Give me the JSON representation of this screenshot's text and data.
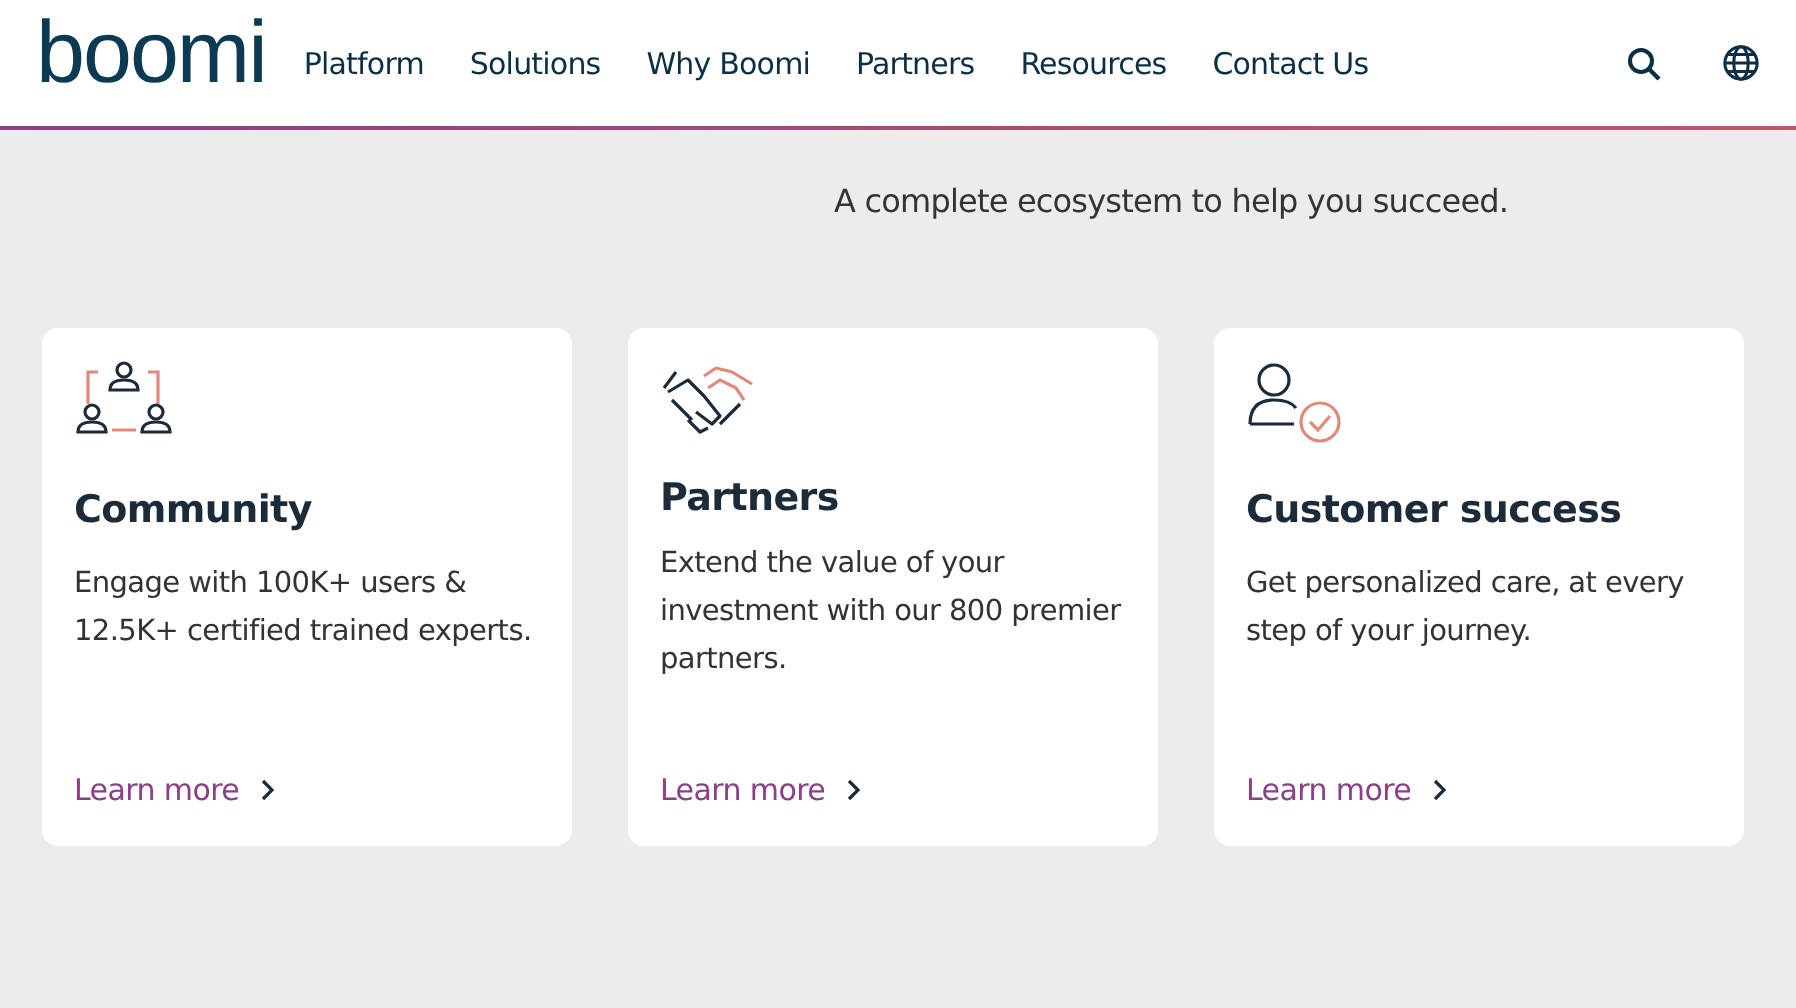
{
  "header": {
    "logo": "boomi",
    "nav": [
      "Platform",
      "Solutions",
      "Why Boomi",
      "Partners",
      "Resources",
      "Contact Us"
    ]
  },
  "tagline": "A complete ecosystem to help you succeed.",
  "cards": [
    {
      "kind": "community",
      "title": "Community",
      "text": "Engage with 100K+ users & 12.5K+ certified trained experts.",
      "link": "Learn more"
    },
    {
      "kind": "partners",
      "title": "Partners",
      "text": "Extend the value of your investment with our 800 premier partners.",
      "link": "Learn more"
    },
    {
      "kind": "success",
      "title": "Customer success",
      "text": "Get personalized care, at every step of your journey.",
      "link": "Learn more"
    }
  ]
}
